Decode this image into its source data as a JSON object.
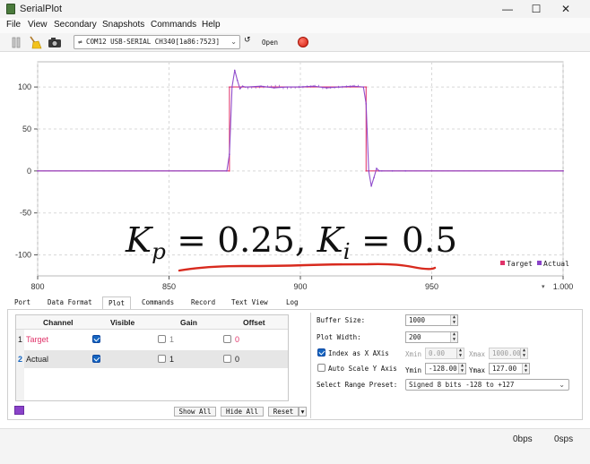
{
  "window": {
    "title": "SerialPlot",
    "minimize": "—",
    "maximize": "☐",
    "close": "✕"
  },
  "menu": [
    "File",
    "View",
    "Secondary",
    "Snapshots",
    "Commands",
    "Help"
  ],
  "menu_underlines": [
    "F",
    "V",
    "",
    "S",
    "C",
    "H"
  ],
  "toolbar": {
    "port_value": "COM12 USB-SERIAL CH340[1a86:7523]",
    "refresh_glyph": "↺",
    "open_label": "Open",
    "icons": [
      "pause-icon",
      "clear-broom-icon",
      "snapshot-camera-icon",
      "usb-icon",
      "record-icon"
    ]
  },
  "annotation": {
    "equation_text": "K_p = 0.25, K_i = 0.5",
    "line_color": "#d82a1e"
  },
  "chart_data": {
    "type": "line",
    "title": "",
    "xlabel": "",
    "ylabel": "",
    "x_ticks": [
      "800",
      "850",
      "900",
      "950",
      "1.000"
    ],
    "y_ticks": [
      "100",
      "50",
      "0",
      "-50",
      "-100"
    ],
    "xlim": [
      800,
      1000
    ],
    "ylim": [
      -125,
      130
    ],
    "grid": true,
    "legend_position": "bottom-right",
    "series": [
      {
        "name": "Target",
        "color": "#e0336a",
        "x": [
          800,
          873,
          873,
          925,
          925,
          1000
        ],
        "y": [
          0,
          0,
          100,
          100,
          0,
          0
        ]
      },
      {
        "name": "Actual",
        "color": "#8a43c9",
        "x": [
          800,
          872,
          873,
          874,
          875,
          876,
          877,
          878,
          879,
          880,
          885,
          890,
          895,
          900,
          905,
          910,
          915,
          920,
          924,
          925,
          926,
          927,
          928,
          929,
          930,
          931,
          935,
          940,
          1000
        ],
        "y": [
          0,
          0,
          20,
          100,
          120,
          108,
          98,
          101,
          100,
          100,
          101,
          99,
          100,
          100,
          101,
          99,
          100,
          101,
          100,
          80,
          0,
          -18,
          -8,
          3,
          0,
          0,
          0,
          0,
          0
        ]
      }
    ]
  },
  "tabs": [
    "Port",
    "Data Format",
    "Plot",
    "Commands",
    "Record",
    "Text View",
    "Log"
  ],
  "active_tab": "Plot",
  "channels": {
    "headers": [
      "Channel",
      "Visible",
      "Gain",
      "Offset"
    ],
    "rows": [
      {
        "num": "1",
        "name": "Target",
        "visible": true,
        "gain_checked": false,
        "gain": "1",
        "offset_checked": false,
        "offset": "0",
        "name_color": "#e0336a"
      },
      {
        "num": "2",
        "name": "Actual",
        "visible": true,
        "gain_checked": false,
        "gain": "1",
        "offset_checked": false,
        "offset": "0",
        "name_color": "#1a1a1a"
      }
    ],
    "selected_color": "#8a43c9",
    "buttons": {
      "show_all": "Show All",
      "hide_all": "Hide All",
      "reset": "Reset",
      "reset_menu": "▾"
    }
  },
  "plot_settings": {
    "buffer_size_label": "Buffer Size:",
    "buffer_size": "1000",
    "plot_width_label": "Plot Width:",
    "plot_width": "200",
    "index_x_label": "Index as X AXis",
    "index_x_checked": true,
    "xmin_label": "Xmin",
    "xmin": "0.00",
    "xmax_label": "Xmax",
    "xmax": "1000.00",
    "autoscale_label": "Auto Scale Y Axis",
    "autoscale_checked": false,
    "ymin_label": "Ymin",
    "ymin": "-128.00",
    "ymax_label": "Ymax",
    "ymax": "127.00",
    "preset_label": "Select Range Preset:",
    "preset_value": "Signed 8 bits -128 to +127"
  },
  "status": {
    "bps": "0bps",
    "sps": "0sps"
  }
}
